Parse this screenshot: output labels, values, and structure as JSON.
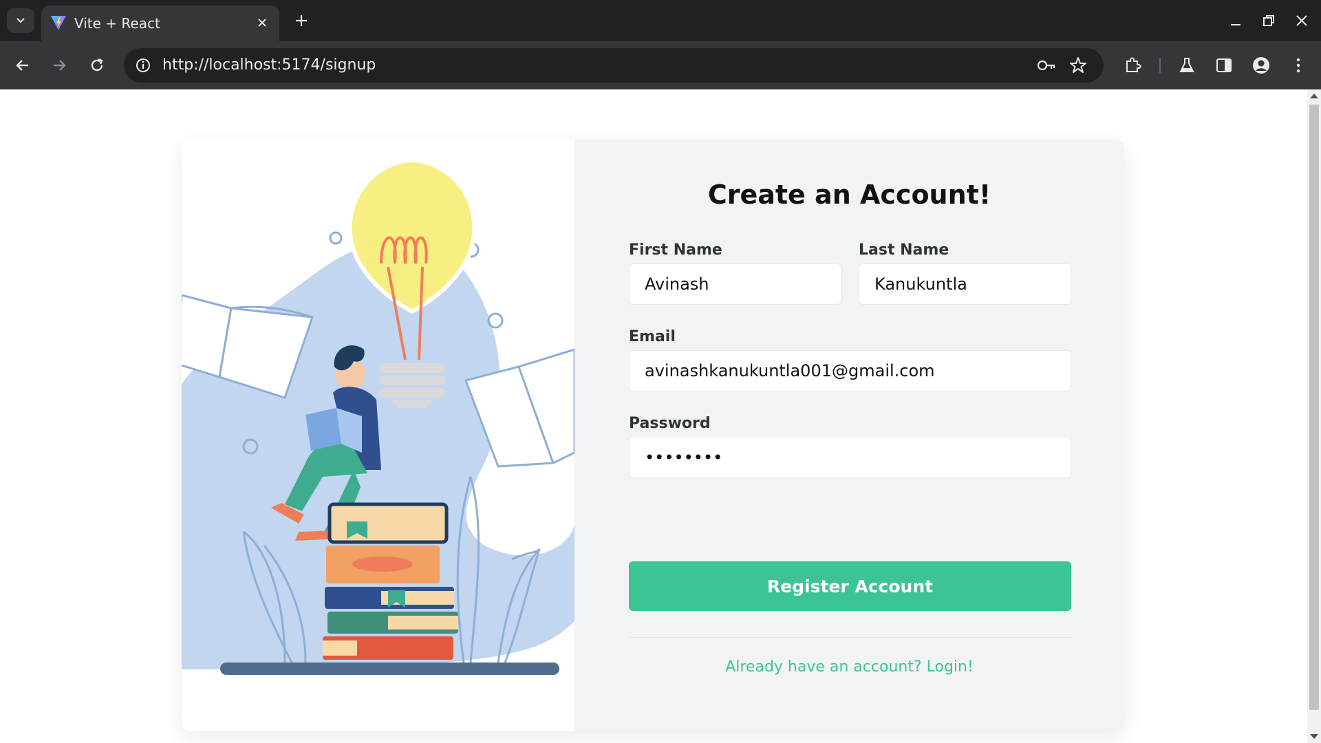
{
  "browser": {
    "tab_title": "Vite + React",
    "url": "http://localhost:5174/signup"
  },
  "form": {
    "title": "Create an Account!",
    "first_name": {
      "label": "First Name",
      "value": "Avinash"
    },
    "last_name": {
      "label": "Last Name",
      "value": "Kanukuntla"
    },
    "email": {
      "label": "Email",
      "value": "avinashkanukuntla001@gmail.com"
    },
    "password": {
      "label": "Password",
      "value": "••••••••"
    },
    "register_label": "Register Account",
    "login_link": "Already have an account? Login!"
  },
  "colors": {
    "accent": "#3cc494",
    "panel_bg": "#f2f3f5",
    "illustration_blob": "#c2d6f0"
  }
}
